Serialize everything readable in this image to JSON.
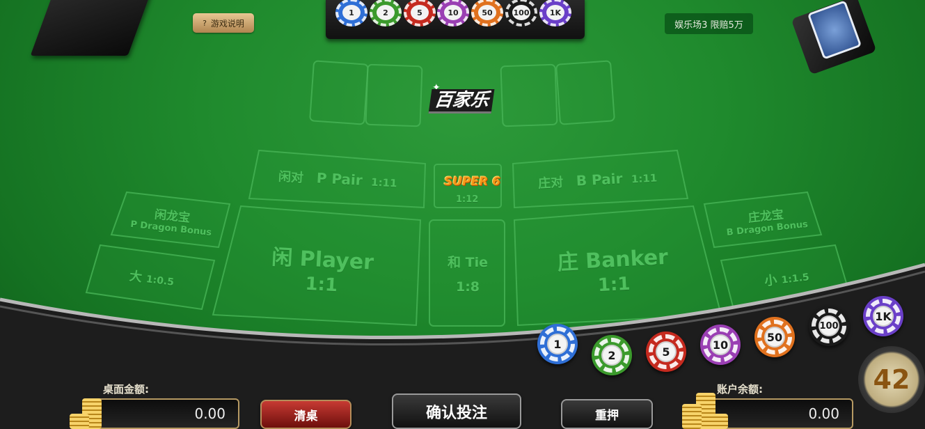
{
  "help_button": {
    "icon": "?",
    "label": "游戏说明"
  },
  "room_badge": "娱乐场3 限赔5万",
  "logo_text": "百家乐",
  "tray_chips": [
    {
      "label": "1",
      "color": "#2f6fd6"
    },
    {
      "label": "2",
      "color": "#3b9a2c"
    },
    {
      "label": "5",
      "color": "#c52a1f"
    },
    {
      "label": "10",
      "color": "#9a3fb3"
    },
    {
      "label": "50",
      "color": "#e0711e"
    },
    {
      "label": "100",
      "color": "#1a1a1a"
    },
    {
      "label": "1K",
      "color": "#6a3fc8"
    }
  ],
  "zones": {
    "p_pair": {
      "cn": "闲对",
      "en": "P Pair",
      "odds": "1:11"
    },
    "b_pair": {
      "cn": "庄对",
      "en": "B Pair",
      "odds": "1:11"
    },
    "super6": {
      "label": "SUPER 6",
      "odds": "1:12"
    },
    "p_dragon": {
      "cn": "闲龙宝",
      "en": "P Dragon Bonus"
    },
    "b_dragon": {
      "cn": "庄龙宝",
      "en": "B Dragon Bonus"
    },
    "big": {
      "cn": "大",
      "odds": "1:0.5"
    },
    "small": {
      "cn": "小",
      "odds": "1:1.5"
    },
    "player": {
      "cn": "闲",
      "en": "Player",
      "odds": "1:1"
    },
    "tie": {
      "cn": "和",
      "en": "Tie",
      "odds": "1:8"
    },
    "banker": {
      "cn": "庄",
      "en": "Banker",
      "odds": "1:1"
    }
  },
  "bet_chips": [
    {
      "label": "1",
      "color": "#2f6fd6"
    },
    {
      "label": "2",
      "color": "#3b9a2c"
    },
    {
      "label": "5",
      "color": "#c52a1f"
    },
    {
      "label": "10",
      "color": "#9a3fb3"
    },
    {
      "label": "50",
      "color": "#e0711e"
    },
    {
      "label": "100",
      "color": "#1a1a1a"
    },
    {
      "label": "1K",
      "color": "#6a3fc8"
    }
  ],
  "timer": "42",
  "table_amount": {
    "label": "桌面金额:",
    "value": "0.00"
  },
  "account_balance": {
    "label": "账户余额:",
    "value": "0.00"
  },
  "buttons": {
    "clear": "清桌",
    "confirm": "确认投注",
    "rebet": "重押"
  }
}
